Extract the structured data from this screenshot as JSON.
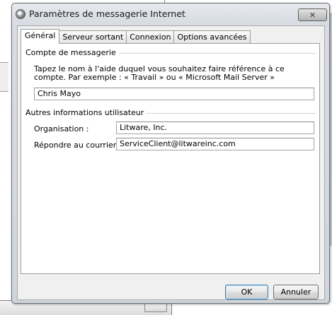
{
  "window": {
    "title": "Paramètres de messagerie Internet",
    "close_glyph": "✕"
  },
  "tabs": [
    {
      "label": "Général",
      "active": true
    },
    {
      "label": "Serveur sortant",
      "active": false
    },
    {
      "label": "Connexion",
      "active": false
    },
    {
      "label": "Options avancées",
      "active": false
    }
  ],
  "account_group": {
    "label": "Compte de messagerie",
    "description": "Tapez le nom à l'aide duquel vous souhaitez faire référence à ce compte. Par exemple : « Travail » ou « Microsoft Mail Server »",
    "account_name_value": "Chris Mayo"
  },
  "user_info_group": {
    "label": "Autres informations utilisateur",
    "organization_label": "Organisation :",
    "organization_value": "Litware, Inc.",
    "reply_label": "Répondre au courrier :",
    "reply_value": "ServiceClient@litwareinc.com"
  },
  "buttons": {
    "ok": "OK",
    "cancel": "Annuler"
  }
}
